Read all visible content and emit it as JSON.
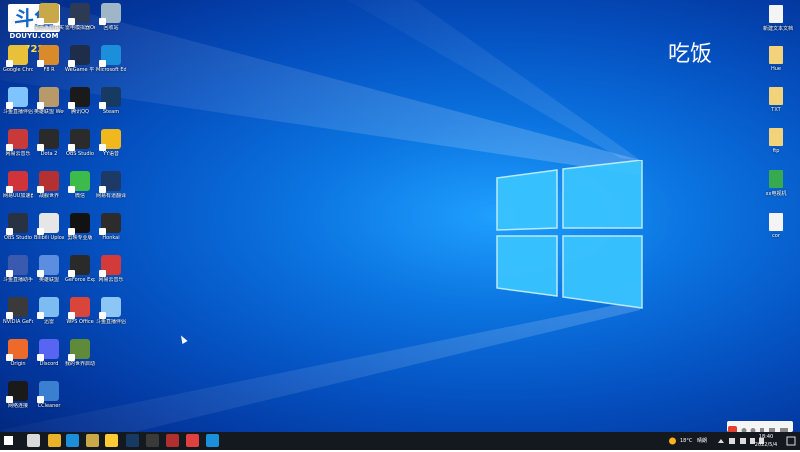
{
  "watermark": {
    "logo_text": "斗鱼",
    "url": "DOUYU.COM",
    "room": "7272213"
  },
  "overlay_text": "吃饭",
  "colors": {
    "desktop": "#0b74e0",
    "taskbar": "#14181f"
  },
  "icons": [
    {
      "label": "",
      "color": "#2a6fd1",
      "icon": "douyu-icon"
    },
    {
      "label": "魔兽争霸真实对战平台",
      "color": "#c9a84a",
      "icon": "warcraft-icon"
    },
    {
      "label": "雷电模拟器Online",
      "color": "#2c3a55",
      "icon": "ldplayer-icon"
    },
    {
      "label": "回收站",
      "color": "#9fb6c9",
      "icon": "recycle-bin-icon"
    },
    {
      "label": "Google Chrome",
      "color": "#e9c03a",
      "icon": "chrome-icon"
    },
    {
      "label": "F8 R",
      "color": "#d98b2c",
      "icon": "game-icon"
    },
    {
      "label": "WeGame 平台",
      "color": "#1e2d4a",
      "icon": "wegame-icon"
    },
    {
      "label": "Microsoft Edge",
      "color": "#1b8fd9",
      "icon": "edge-icon"
    },
    {
      "label": "斗鱼直播伴侣",
      "color": "#7fc3ff",
      "icon": "douyu-helper-icon"
    },
    {
      "label": "英雄联盟 WeGame版",
      "color": "#b89a6a",
      "icon": "lol-icon"
    },
    {
      "label": "腾讯QQ",
      "color": "#1a1a1a",
      "icon": "qq-icon"
    },
    {
      "label": "Steam",
      "color": "#173a63",
      "icon": "steam-icon"
    },
    {
      "label": "网易云音乐",
      "color": "#c83a3a",
      "icon": "netease-music-icon"
    },
    {
      "label": "Dota 2",
      "color": "#2a2a2a",
      "icon": "dota-icon"
    },
    {
      "label": "OBS Studio",
      "color": "#2b2b2b",
      "icon": "obs-icon"
    },
    {
      "label": "YY语音",
      "color": "#f0b81c",
      "icon": "yy-icon"
    },
    {
      "label": "网易UU加速器",
      "color": "#d0333a",
      "icon": "uu-icon"
    },
    {
      "label": "战舰世界",
      "color": "#b53030",
      "icon": "wows-icon"
    },
    {
      "label": "微信",
      "color": "#3cbb4a",
      "icon": "wechat-icon"
    },
    {
      "label": "网易有道翻译",
      "color": "#1d3a66",
      "icon": "youdao-icon"
    },
    {
      "label": "OBS Studio",
      "color": "#293242",
      "icon": "obs-icon"
    },
    {
      "label": "Bilibili Uploader",
      "color": "#e6e6e6",
      "icon": "bilibili-icon"
    },
    {
      "label": "剪映专业版",
      "color": "#121212",
      "icon": "capcut-icon"
    },
    {
      "label": "Honkai",
      "color": "#2c2c2c",
      "icon": "game-icon"
    },
    {
      "label": "斗鱼直播助手",
      "color": "#3a5ab0",
      "icon": "douyu-helper-icon"
    },
    {
      "label": "英雄联盟",
      "color": "#5b8de0",
      "icon": "lol-icon"
    },
    {
      "label": "GeForce Experience",
      "color": "#2a2a2a",
      "icon": "geforce-icon"
    },
    {
      "label": "网易云音乐",
      "color": "#d33a3a",
      "icon": "netease-music-icon"
    },
    {
      "label": "NVIDIA GeForce",
      "color": "#3a3a3a",
      "icon": "nvidia-icon"
    },
    {
      "label": "迅雷",
      "color": "#7cbcf2",
      "icon": "xunlei-icon"
    },
    {
      "label": "WPS Office",
      "color": "#d9453a",
      "icon": "wps-icon"
    },
    {
      "label": "斗鱼直播伴侣",
      "color": "#8cc6f5",
      "icon": "douyu-helper-icon"
    },
    {
      "label": "Origin",
      "color": "#ee6a2a",
      "icon": "origin-icon"
    },
    {
      "label": "Discord",
      "color": "#5865f2",
      "icon": "discord-icon"
    },
    {
      "label": "我的世界启动器",
      "color": "#5e8a3a",
      "icon": "minecraft-icon"
    },
    {
      "label": "网络连接",
      "color": "#1a1a1a",
      "icon": "wifi-icon"
    },
    {
      "label": "CCleaner",
      "color": "#3a7fd0",
      "icon": "ccleaner-icon"
    }
  ],
  "right_files": [
    {
      "label": "新建文本文档",
      "color": "#f4f4f4",
      "icon": "text-file-icon"
    },
    {
      "label": "Hue",
      "color": "#f2d27a",
      "icon": "folder-icon"
    },
    {
      "label": "TXT",
      "color": "#f2d27a",
      "icon": "folder-icon"
    },
    {
      "label": "ftp",
      "color": "#f2d27a",
      "icon": "folder-icon"
    },
    {
      "label": "xx电视机",
      "color": "#37a94f",
      "icon": "excel-file-icon"
    },
    {
      "label": "cor",
      "color": "#f4f4f4",
      "icon": "file-icon"
    }
  ],
  "taskbar": {
    "apps": [
      {
        "name": "start-button",
        "color": "#ffffff"
      },
      {
        "name": "search",
        "color": "#dadada"
      },
      {
        "name": "file-explorer",
        "color": "#e8b32a"
      },
      {
        "name": "edge",
        "color": "#1b8fd9"
      },
      {
        "name": "wegame",
        "color": "#c9a84a"
      },
      {
        "name": "game",
        "color": "#ffcc33"
      },
      {
        "name": "steam",
        "color": "#173a63"
      },
      {
        "name": "obs",
        "color": "#3a3a3a"
      },
      {
        "name": "obs-running",
        "color": "#b03030"
      },
      {
        "name": "netease",
        "color": "#e04040"
      },
      {
        "name": "douyu",
        "color": "#1b8fd9"
      }
    ],
    "weather": "18°C",
    "weather_desc": "晴朗",
    "time": "18:40",
    "date": "2022/5/4"
  }
}
